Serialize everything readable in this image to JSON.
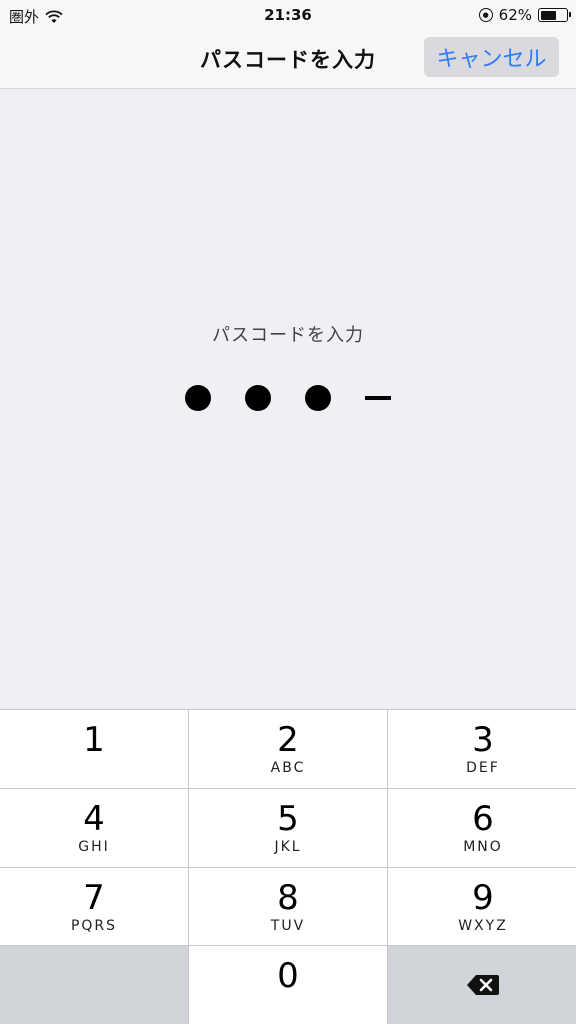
{
  "status": {
    "carrier": "圏外",
    "time": "21:36",
    "battery": "62%",
    "battery_level": 0.62
  },
  "nav": {
    "title": "パスコードを入力",
    "cancel_label": "キャンセル"
  },
  "prompt": "パスコードを入力",
  "passcode": {
    "entered": 3,
    "length": 4
  },
  "keypad": {
    "keys": [
      {
        "digit": "1",
        "letters": ""
      },
      {
        "digit": "2",
        "letters": "ABC"
      },
      {
        "digit": "3",
        "letters": "DEF"
      },
      {
        "digit": "4",
        "letters": "GHI"
      },
      {
        "digit": "5",
        "letters": "JKL"
      },
      {
        "digit": "6",
        "letters": "MNO"
      },
      {
        "digit": "7",
        "letters": "PQRS"
      },
      {
        "digit": "8",
        "letters": "TUV"
      },
      {
        "digit": "9",
        "letters": "WXYZ"
      },
      {
        "digit": "0",
        "letters": ""
      }
    ],
    "delete_icon": "backspace-icon"
  },
  "colors": {
    "accent": "#2f7cf6",
    "background": "#efeff4"
  }
}
